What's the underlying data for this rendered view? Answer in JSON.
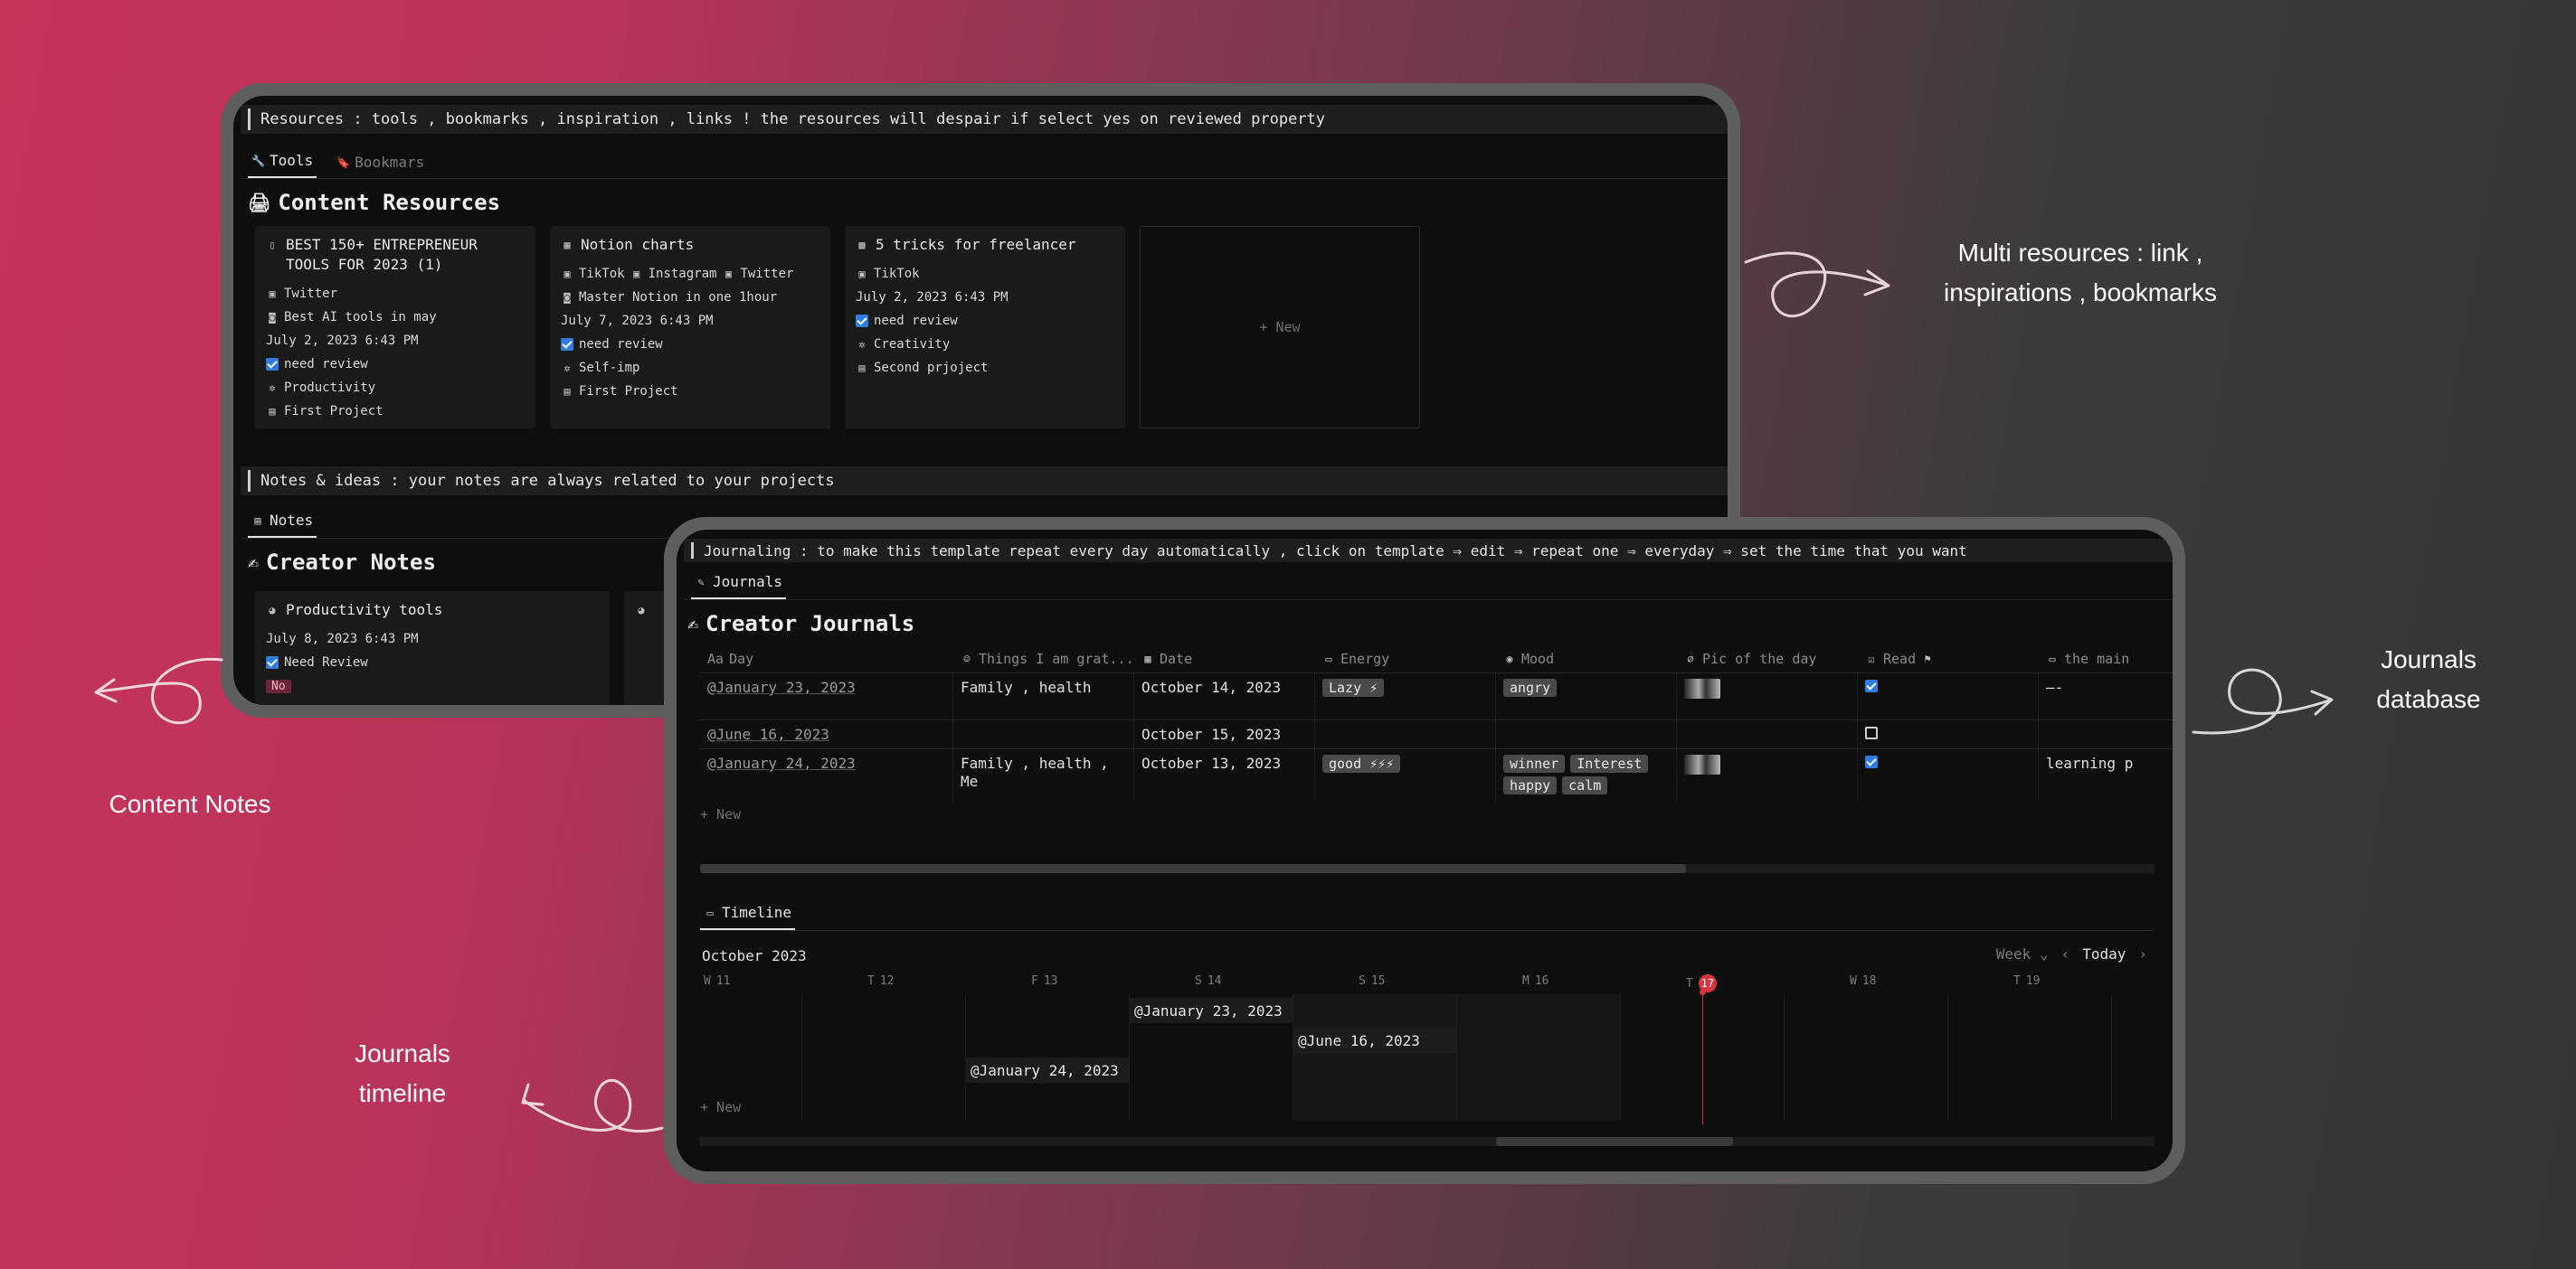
{
  "resources_window": {
    "callout": "Resources : tools , bookmarks , inspiration , links  ! the resources will despair if select yes on reviewed property",
    "tabs": [
      {
        "label": "Tools"
      },
      {
        "label": "Bookmars"
      }
    ],
    "title": "Content Resources",
    "cards": [
      {
        "title": "BEST 150+ ENTREPRENEUR TOOLS FOR 2023 (1)",
        "rows": [
          "Twitter",
          "Best AI tools in may",
          "July 2, 2023 6:43 PM",
          "need review",
          "Productivity",
          "First Project"
        ]
      },
      {
        "title": "Notion charts",
        "tags": [
          "TikTok",
          "Instagram",
          "Twitter"
        ],
        "rows": [
          "Master Notion in one 1hour",
          "July 7, 2023 6:43 PM",
          "need review",
          "Self-imp",
          "First Project"
        ]
      },
      {
        "title": "5 tricks for freelancer",
        "rows": [
          "TikTok",
          "July 2, 2023 6:43 PM",
          "need review",
          "Creativity",
          "Second prjoject"
        ]
      }
    ],
    "new_label": "+ New",
    "notes_callout": "Notes & ideas : your notes are always related to your projects",
    "notes_tab": "Notes",
    "notes_title": "Creator Notes",
    "note_card": {
      "title": "Productivity tools",
      "date": "July 8, 2023 6:43 PM",
      "review": "Need Review",
      "badge": "No"
    }
  },
  "journals_window": {
    "callout": "Journaling : to make this template repeat every day automatically , click on template ⇒ edit ⇒ repeat one ⇒ everyday ⇒ set the time that you want",
    "tab": "Journals",
    "title": "Creator Journals",
    "columns": [
      "Day",
      "Things I am grat...",
      "Date",
      "Energy",
      "Mood",
      "Pic of the day",
      "Read",
      "the main"
    ],
    "col_prefix": "Aa",
    "rows": [
      {
        "day": "@January 23, 2023",
        "things": "Family , health",
        "date": "October 14, 2023",
        "energy": "Lazy ⚡",
        "mood": [
          "angry"
        ],
        "read": true,
        "main": "—-"
      },
      {
        "day": "@June 16, 2023",
        "things": "",
        "date": "October 15, 2023",
        "energy": "",
        "mood": [],
        "read": false,
        "main": ""
      },
      {
        "day": "@January 24, 2023",
        "things": "Family , health , Me",
        "date": "October 13, 2023",
        "energy": "good ⚡⚡⚡",
        "mood": [
          "winner",
          "Interest",
          "happy",
          "calm"
        ],
        "read": true,
        "main": "learning p"
      }
    ],
    "new_label": "+ New",
    "timeline": {
      "tab": "Timeline",
      "month": "October 2023",
      "view": "Week",
      "today": "Today",
      "days": [
        {
          "d": "W",
          "n": "11"
        },
        {
          "d": "T",
          "n": "12"
        },
        {
          "d": "F",
          "n": "13"
        },
        {
          "d": "S",
          "n": "14"
        },
        {
          "d": "S",
          "n": "15"
        },
        {
          "d": "M",
          "n": "16"
        },
        {
          "d": "T",
          "n": "17"
        },
        {
          "d": "W",
          "n": "18"
        },
        {
          "d": "T",
          "n": "19"
        }
      ],
      "items": [
        "@January 23, 2023",
        "@June 16, 2023",
        "@January 24, 2023"
      ],
      "new_label": "+ New"
    }
  },
  "annotations": {
    "multi": "Multi resources : link , inspirations , bookmarks",
    "journals_db": "Journals database",
    "content_notes": "Content Notes",
    "journals_timeline": "Journals timeline"
  },
  "colors": {
    "accent_blue": "#2f7de1",
    "today_red": "#d8343f",
    "badge_no": "#6e2438"
  },
  "icons": [
    "wrench-icon",
    "bookmark-icon",
    "printer-icon",
    "check-icon",
    "cross-icon",
    "journal-icon",
    "timeline-icon"
  ]
}
